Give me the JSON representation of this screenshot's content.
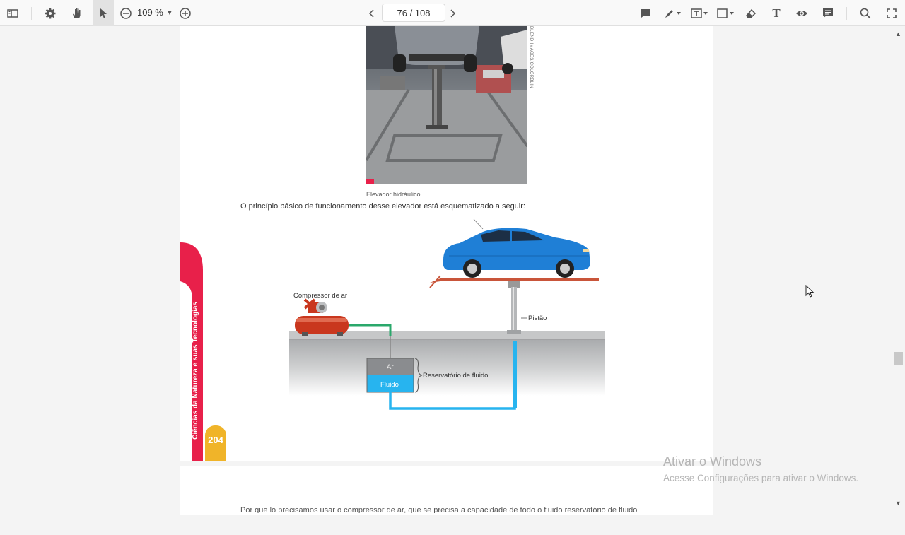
{
  "toolbar": {
    "zoom": "109 %",
    "page_indicator": "76 / 108"
  },
  "page": {
    "photo_credit": "BLEND IMAGES/COLORBLIN",
    "photo_caption": "Elevador hidráulico.",
    "intro_text": "O princípio básico de funcionamento desse elevador está esquematizado a seguir:",
    "side_label": "Ciências da Natureza e suas Tecnologias",
    "page_number": "204",
    "diagram": {
      "compressor": "Compressor de ar",
      "piston": "Pistão",
      "air": "Ar",
      "fluid": "Fluido",
      "reservoir": "Reservatório de fluido"
    },
    "next_page_text": "Por que lo precisamos usar o compressor de ar, que se precisa a capacidade de todo o fluido reservatório de fluido"
  },
  "watermark": {
    "title": "Ativar o Windows",
    "subtitle": "Acesse Configurações para ativar o Windows."
  },
  "colors": {
    "accent_red": "#e8204a",
    "page_number_bg": "#f0b429",
    "car_blue": "#1f7fd6",
    "fluid_blue": "#27b4ef",
    "pipe_green": "#2aa86b"
  }
}
